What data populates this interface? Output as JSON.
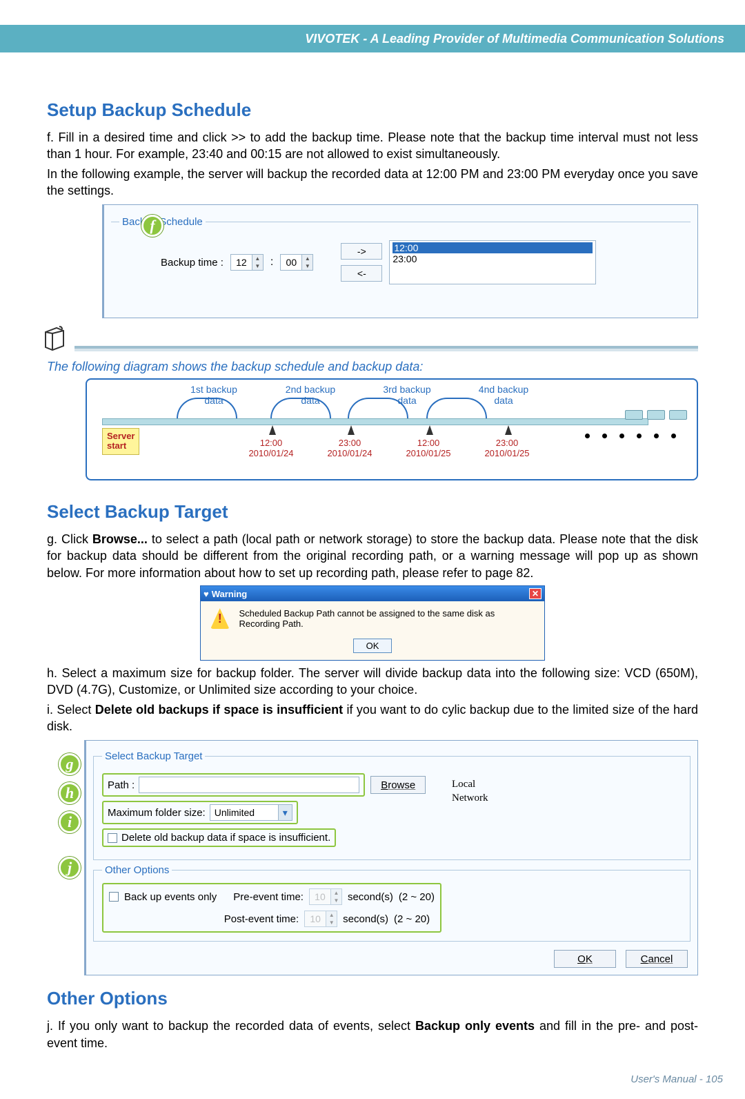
{
  "header": {
    "title": "VIVOTEK - A Leading Provider of Multimedia Communication Solutions"
  },
  "section1": {
    "title": "Setup Backup Schedule",
    "para_f": "f. Fill in a desired time and click >> to add the backup time. Please note that the backup time interval must not less than 1 hour. For example, 23:40 and 00:15 are not allowed to exist simultaneously.",
    "para_f2": "In the following example, the server will backup the recorded data at 12:00 PM and 23:00 PM everyday once you save the settings."
  },
  "backup_schedule": {
    "legend": "Backup Schedule",
    "label": "Backup time :",
    "hour": "12",
    "minute": "00",
    "add": "->",
    "remove": "<-",
    "times": {
      "selected": "12:00",
      "other": "23:00"
    }
  },
  "step_labels": {
    "f": "f",
    "g": "g",
    "h": "h",
    "i": "i",
    "j": "j"
  },
  "diagram_note": "The following diagram shows the backup schedule and backup data:",
  "diagram": {
    "tops": [
      "1st backup data",
      "2nd backup data",
      "3rd backup data",
      "4nd backup data"
    ],
    "server": "Server\nstart",
    "times": [
      {
        "t": "12:00",
        "d": "2010/01/24"
      },
      {
        "t": "23:00",
        "d": "2010/01/24"
      },
      {
        "t": "12:00",
        "d": "2010/01/25"
      },
      {
        "t": "23:00",
        "d": "2010/01/25"
      }
    ]
  },
  "section2": {
    "title": "Select Backup Target",
    "para_g1": "g. Click ",
    "para_g_bold": "Browse...",
    "para_g2": " to select a path (local path or network storage) to store the backup data. Please note that the disk for backup data should be different from the original recording path, or a warning message will pop up as shown below. For more information about how to set up recording path, please refer to page 82.",
    "para_h": "h. Select a maximum size for backup folder. The server will divide backup data into the following size: VCD (650M), DVD (4.7G), Customize, or Unlimited size according to your choice.",
    "para_i1": "i. Select ",
    "para_i_bold": "Delete old backups if space is insufficient",
    "para_i2": " if you want to do cylic backup due to the limited size of the hard disk."
  },
  "warning": {
    "title": "Warning",
    "message": "Scheduled Backup Path cannot be assigned to the same disk as Recording Path.",
    "ok": "OK"
  },
  "select_target": {
    "legend": "Select Backup Target",
    "path_label": "Path :",
    "path_value": "",
    "browse": "Browse",
    "browse_list": {
      "local": "Local",
      "network": "Network"
    },
    "maxsize_label": "Maximum folder size:",
    "maxsize_value": "Unlimited",
    "delete_old": "Delete old backup data if space is insufficient."
  },
  "other_options": {
    "legend": "Other Options",
    "backup_events": "Back up events only",
    "pre_label": "Pre-event time:",
    "post_label": "Post-event time:",
    "pre_val": "10",
    "post_val": "10",
    "sec": "second(s)",
    "range": "(2 ~ 20)"
  },
  "buttons": {
    "ok": "OK",
    "cancel": "Cancel"
  },
  "section3": {
    "title": "Other Options",
    "para_j1": "j. If you only want to backup the recorded data of events, select ",
    "para_j_bold": "Backup only events",
    "para_j2": " and fill in the pre- and post-event time."
  },
  "footer": {
    "text": "User's Manual - 105"
  }
}
